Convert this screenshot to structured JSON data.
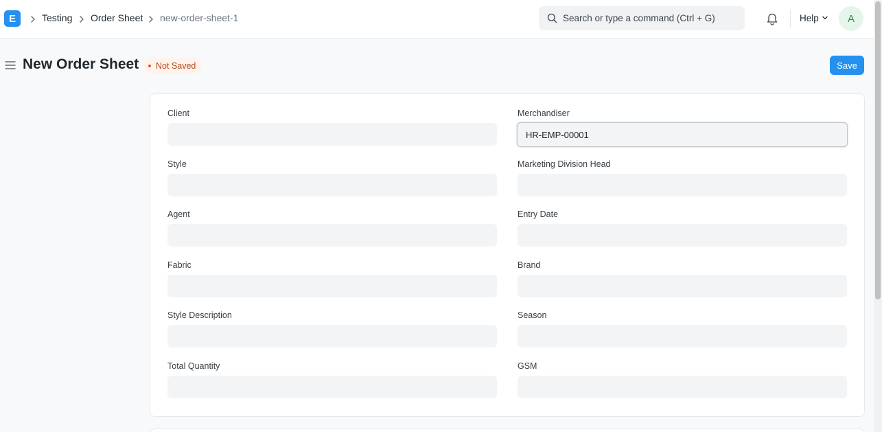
{
  "app": {
    "logo_letter": "E"
  },
  "breadcrumb": [
    "Testing",
    "Order Sheet",
    "new-order-sheet-1"
  ],
  "search": {
    "placeholder": "Search or type a command (Ctrl + G)"
  },
  "header": {
    "help_label": "Help",
    "avatar_letter": "A"
  },
  "page": {
    "title": "New Order Sheet",
    "status": "Not Saved",
    "save_label": "Save"
  },
  "form": {
    "left": [
      {
        "label": "Client",
        "value": ""
      },
      {
        "label": "Style",
        "value": ""
      },
      {
        "label": "Agent",
        "value": ""
      },
      {
        "label": "Fabric",
        "value": ""
      },
      {
        "label": "Style Description",
        "value": ""
      },
      {
        "label": "Total Quantity",
        "value": ""
      }
    ],
    "right": [
      {
        "label": "Merchandiser",
        "value": "HR-EMP-00001"
      },
      {
        "label": "Marketing Division Head",
        "value": ""
      },
      {
        "label": "Entry Date",
        "value": ""
      },
      {
        "label": "Brand",
        "value": ""
      },
      {
        "label": "Season",
        "value": ""
      },
      {
        "label": "GSM",
        "value": ""
      }
    ]
  },
  "colors": {
    "primary": "#2490ef",
    "status": "#b2491c",
    "status_bg": "#fff3ec"
  },
  "icons": [
    "chevron-right-icon",
    "search-icon",
    "bell-icon",
    "chevron-down-icon",
    "menu-icon"
  ]
}
